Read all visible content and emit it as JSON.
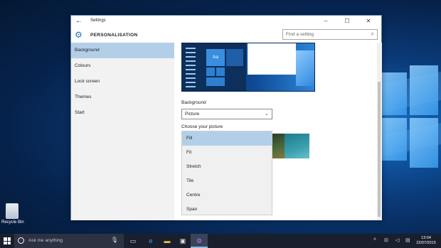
{
  "window": {
    "title": "Settings",
    "controls": {
      "minimize": "–",
      "maximize": "☐",
      "close": "✕"
    },
    "section_title": "PERSONALISATION",
    "search_placeholder": "Find a setting"
  },
  "sidebar": {
    "items": [
      {
        "label": "Background",
        "active": true
      },
      {
        "label": "Colours"
      },
      {
        "label": "Lock screen"
      },
      {
        "label": "Themes"
      },
      {
        "label": "Start"
      }
    ]
  },
  "content": {
    "preview_tile_label": "Aa",
    "background_label": "Background",
    "background_value": "Picture",
    "choose_picture_label": "Choose your picture",
    "fit_options": [
      "Fill",
      "Fit",
      "Stretch",
      "Tile",
      "Centre",
      "Span"
    ],
    "selected_fit": "Fill"
  },
  "desktop": {
    "recycle_bin_label": "Recycle Bin"
  },
  "taskbar": {
    "search_placeholder": "Ask me anything",
    "time": "13:04",
    "date": "22/07/2015"
  },
  "icons": {
    "back": "back-arrow-icon",
    "settings": "gear-icon",
    "search": "search-icon",
    "dropdown": "chevron-down-icon",
    "start": "windows-start-icon",
    "mic": "microphone-icon"
  },
  "colors": {
    "accent_selected": "#b3cfe8",
    "taskbar": "#1a1f2e",
    "settings_icon": "#2a6fb8"
  }
}
